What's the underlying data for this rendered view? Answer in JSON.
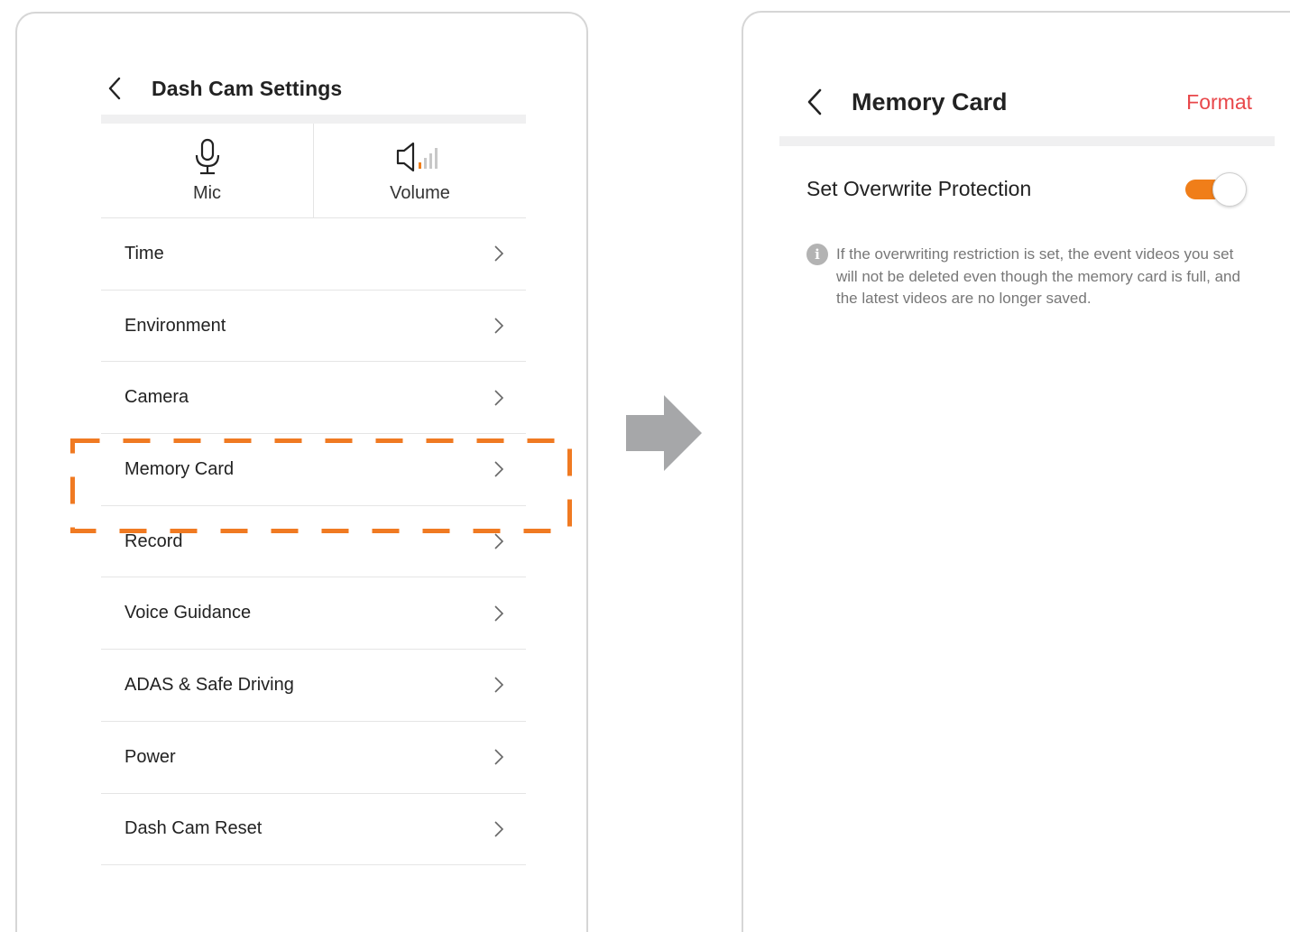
{
  "left_screen": {
    "title": "Dash Cam Settings",
    "toggles": [
      {
        "label": "Mic",
        "icon": "microphone-icon"
      },
      {
        "label": "Volume",
        "icon": "speaker-volume-icon"
      }
    ],
    "menu_items": [
      {
        "label": "Time"
      },
      {
        "label": "Environment"
      },
      {
        "label": "Camera"
      },
      {
        "label": "Memory Card",
        "highlighted": true
      },
      {
        "label": "Record"
      },
      {
        "label": "Voice Guidance"
      },
      {
        "label": "ADAS & Safe Driving"
      },
      {
        "label": "Power"
      },
      {
        "label": "Dash Cam Reset"
      }
    ]
  },
  "right_screen": {
    "title": "Memory Card",
    "format_label": "Format",
    "setting_label": "Set Overwrite Protection",
    "setting_enabled": true,
    "info_text": "If the overwriting restriction is set, the event videos you set will not be deleted even though the memory card is full, and the latest videos are no longer saved."
  },
  "colors": {
    "accent_orange": "#f07e19",
    "format_red": "#e8474a",
    "arrow_gray": "#a6a7a9",
    "highlight_dash": "#f07a22"
  }
}
